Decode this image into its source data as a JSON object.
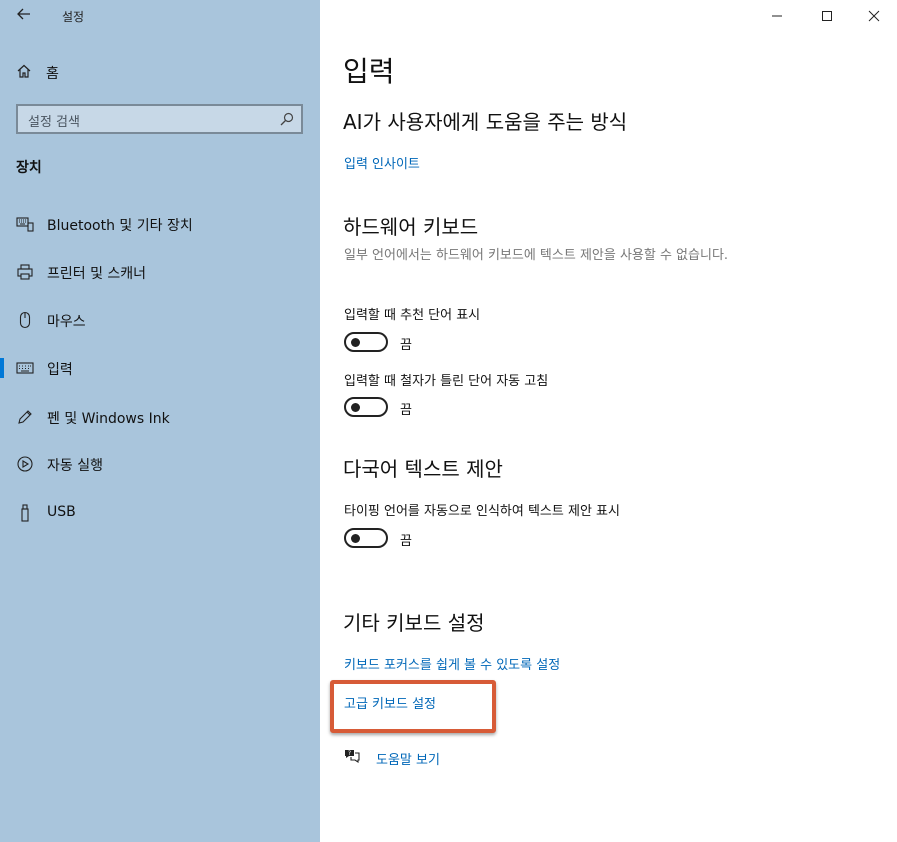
{
  "window": {
    "title": "설정",
    "back_icon": "back-arrow-icon",
    "minimize_icon": "minimize-icon",
    "maximize_icon": "maximize-icon",
    "close_icon": "close-icon"
  },
  "sidebar": {
    "home_label": "홈",
    "search_placeholder": "설정 검색",
    "section_title": "장치",
    "items": [
      {
        "label": "Bluetooth 및 기타 장치",
        "icon": "bluetooth-devices-icon",
        "active": false
      },
      {
        "label": "프린터 및 스캐너",
        "icon": "printer-icon",
        "active": false
      },
      {
        "label": "마우스",
        "icon": "mouse-icon",
        "active": false
      },
      {
        "label": "입력",
        "icon": "keyboard-icon",
        "active": true
      },
      {
        "label": "펜 및 Windows Ink",
        "icon": "pen-icon",
        "active": false
      },
      {
        "label": "자동 실행",
        "icon": "autoplay-icon",
        "active": false
      },
      {
        "label": "USB",
        "icon": "usb-icon",
        "active": false
      }
    ]
  },
  "main": {
    "page_title": "입력",
    "ai_section": {
      "title": "AI가 사용자에게 도움을 주는 방식",
      "link": "입력 인사이트"
    },
    "hardware_section": {
      "title": "하드웨어 키보드",
      "description": "일부 언어에서는 하드웨어 키보드에 텍스트 제안을 사용할 수 없습니다.",
      "settings": [
        {
          "label": "입력할 때 추천 단어 표시",
          "state": "끔"
        },
        {
          "label": "입력할 때 철자가 틀린 단어 자동 고침",
          "state": "끔"
        }
      ]
    },
    "multilingual_section": {
      "title": "다국어 텍스트 제안",
      "settings": [
        {
          "label": "타이핑 언어를 자동으로 인식하여 텍스트 제안 표시",
          "state": "끔"
        }
      ]
    },
    "other_section": {
      "title": "기타 키보드 설정",
      "link_focus": "키보드 포커스를 쉽게 볼 수 있도록 설정",
      "link_advanced": "고급 키보드 설정",
      "help_label": "도움말 보기"
    }
  },
  "colors": {
    "sidebar_bg": "#a9c5dc",
    "accent": "#0078d7",
    "link": "#0067b8",
    "highlight": "#d75b37"
  }
}
